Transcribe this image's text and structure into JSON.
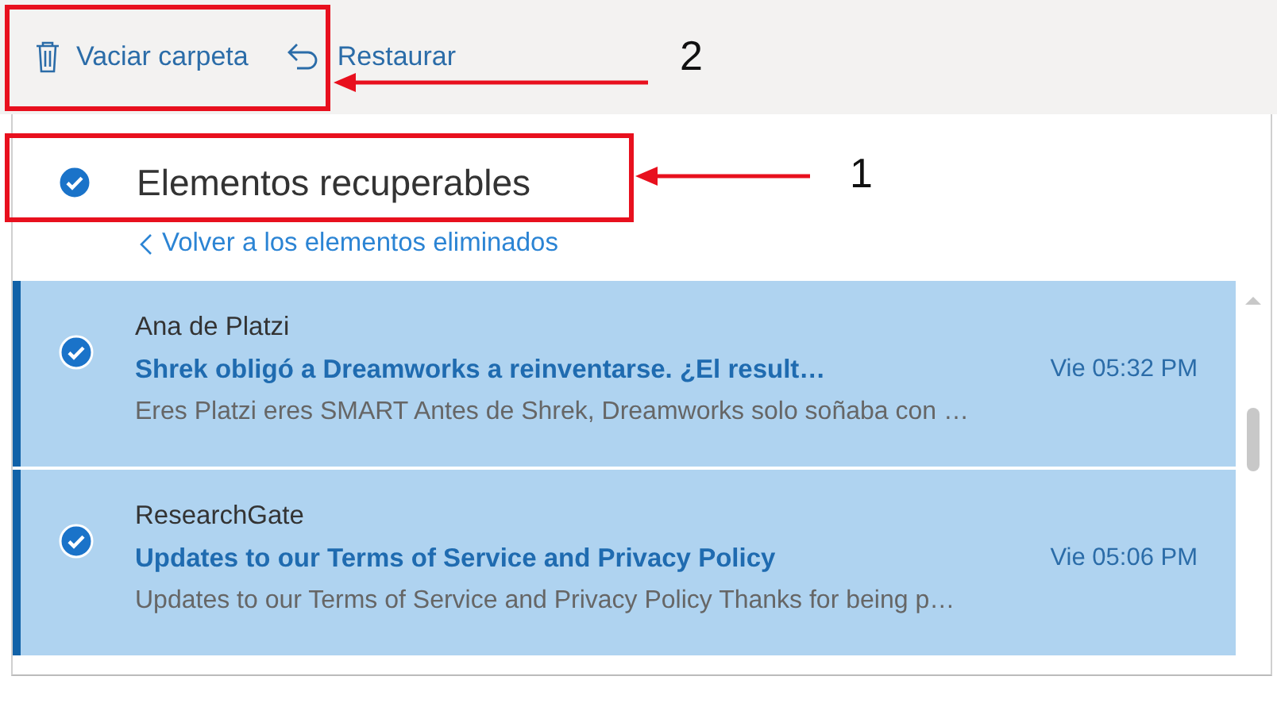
{
  "toolbar": {
    "buttons": [
      {
        "label": "Vaciar carpeta",
        "kind": "delete"
      },
      {
        "label": "Restaurar",
        "kind": "restore"
      }
    ]
  },
  "header": {
    "title": "Elementos recuperables",
    "checked": true
  },
  "back_link": {
    "label": "Volver a los elementos eliminados"
  },
  "messages": [
    {
      "sender": "Ana de Platzi",
      "subject": "Shrek obligó a Dreamworks a reinventarse. ¿El result…",
      "time": "Vie 05:32 PM",
      "preview": "Eres Platzi eres SMART Antes de Shrek, Dreamworks solo soñaba con …",
      "selected": true,
      "checked": true
    },
    {
      "sender": "ResearchGate",
      "subject": "Updates to our Terms of Service and Privacy Policy",
      "time": "Vie 05:06 PM",
      "preview": "Updates to our Terms of Service and Privacy Policy Thanks for being p…",
      "selected": true,
      "checked": true
    }
  ],
  "annotations": [
    {
      "number": "2"
    },
    {
      "number": "1"
    }
  ]
}
